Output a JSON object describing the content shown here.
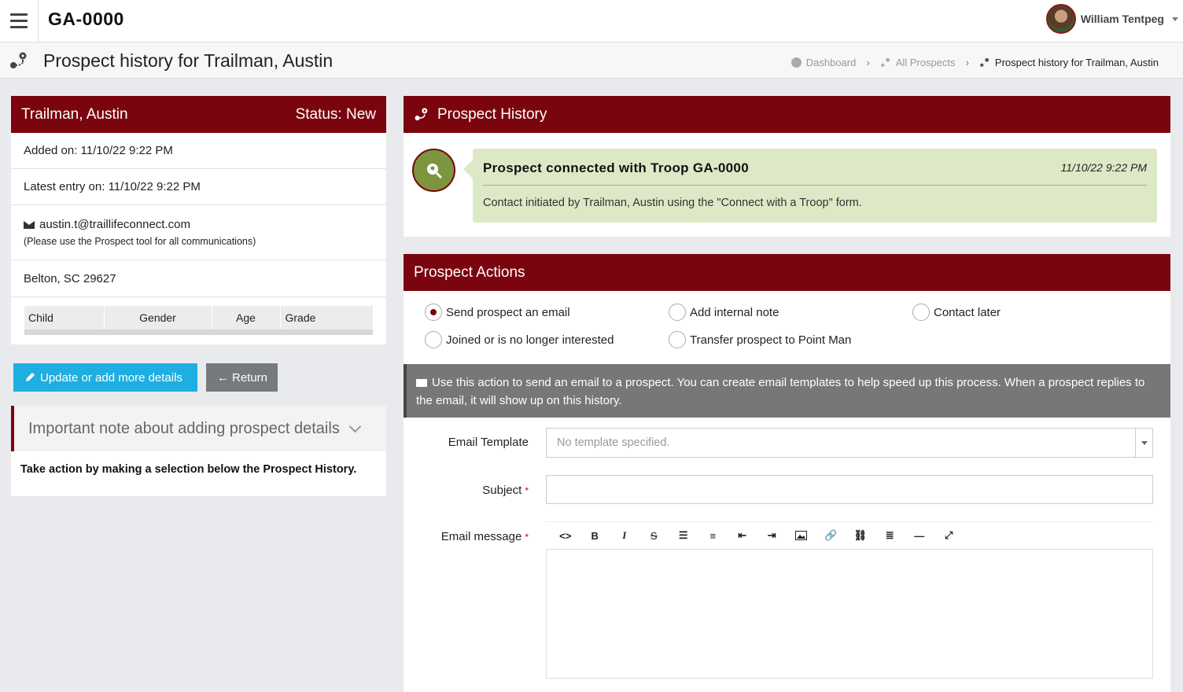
{
  "app": {
    "title": "GA-0000"
  },
  "user": {
    "name": "William Tentpeg"
  },
  "page": {
    "title": "Prospect history for Trailman, Austin"
  },
  "breadcrumb": [
    {
      "label": "Dashboard"
    },
    {
      "label": "All Prospects"
    },
    {
      "label": "Prospect history for Trailman, Austin"
    }
  ],
  "prospect": {
    "name": "Trailman, Austin",
    "status": "Status: New",
    "added": "Added on: 11/10/22 9:22 PM",
    "latest": "Latest entry on: 11/10/22 9:22 PM",
    "email": "austin.t@traillifeconnect.com",
    "email_note": "(Please use the Prospect tool for all communications)",
    "location": "Belton, SC 29627",
    "child_table": {
      "headers": [
        "Child",
        "Gender",
        "Age",
        "Grade"
      ],
      "rows": []
    }
  },
  "buttons": {
    "update": "Update or add more details",
    "return": "Return"
  },
  "note": {
    "title": "Important note about adding prospect details",
    "body": "Take action by making a selection below the Prospect History."
  },
  "history": {
    "title": "Prospect History",
    "entries": [
      {
        "title": "Prospect connected with Troop GA-0000",
        "time": "11/10/22 9:22 PM",
        "text": "Contact initiated by Trailman, Austin using the \"Connect with a Troop\" form."
      }
    ]
  },
  "actions": {
    "title": "Prospect Actions",
    "options": [
      {
        "label": "Send prospect an email",
        "selected": true
      },
      {
        "label": "Add internal note",
        "selected": false
      },
      {
        "label": "Contact later",
        "selected": false
      },
      {
        "label": "Joined or is no longer interested",
        "selected": false
      },
      {
        "label": "Transfer prospect to Point Man",
        "selected": false
      }
    ],
    "info": "Use this action to send an email to a prospect. You can create email templates to help speed up this process. When a prospect replies to the email, it will show up on this history.",
    "form": {
      "template_label": "Email Template",
      "template_placeholder": "No template specified.",
      "subject_label": "Subject",
      "subject_value": "",
      "message_label": "Email message",
      "required_mark": "*"
    },
    "toolbar": [
      "code-view",
      "bold",
      "italic",
      "strikethrough",
      "bulleted-list",
      "numbered-list",
      "outdent",
      "indent",
      "image",
      "link",
      "unlink",
      "align",
      "horizontal-rule",
      "fullscreen"
    ]
  },
  "colors": {
    "brand": "#7b050f",
    "accent": "#1eaee1",
    "history_card": "#dde9c6"
  }
}
